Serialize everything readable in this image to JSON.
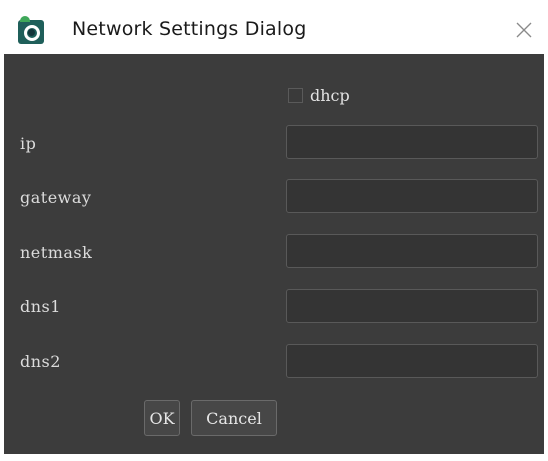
{
  "window": {
    "title": "Network Settings Dialog",
    "app_icon": "app-logo-icon",
    "close_icon": "close-icon"
  },
  "form": {
    "dhcp": {
      "label": "dhcp",
      "checked": false
    },
    "fields": [
      {
        "label": "ip",
        "value": ""
      },
      {
        "label": "gateway",
        "value": ""
      },
      {
        "label": "netmask",
        "value": ""
      },
      {
        "label": "dns1",
        "value": ""
      },
      {
        "label": "dns2",
        "value": ""
      }
    ]
  },
  "buttons": {
    "ok": "OK",
    "cancel": "Cancel"
  },
  "colors": {
    "client_background": "#3c3c3c",
    "field_background": "#343434",
    "text": "#dcdcdc"
  }
}
